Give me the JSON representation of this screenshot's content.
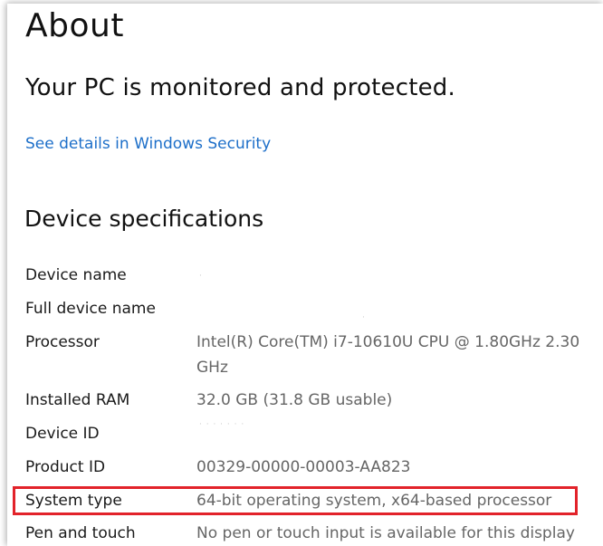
{
  "page": {
    "title": "About"
  },
  "security": {
    "heading": "Your PC is monitored and protected.",
    "link": "See details in Windows Security"
  },
  "specs": {
    "heading": "Device specifications",
    "rows": [
      {
        "label": "Device name",
        "value": ""
      },
      {
        "label": "Full device name",
        "value": ""
      },
      {
        "label": "Processor",
        "value_line1": "Intel(R) Core(TM) i7-10610U CPU @ 1.80GHz   2.30",
        "value_line2": "GHz"
      },
      {
        "label": "Installed RAM",
        "value": "32.0 GB (31.8 GB usable)"
      },
      {
        "label": "Device ID",
        "value": ""
      },
      {
        "label": "Product ID",
        "value": "00329-00000-00003-AA823"
      },
      {
        "label": "System type",
        "value": "64-bit operating system, x64-based processor"
      },
      {
        "label": "Pen and touch",
        "value": "No pen or touch input is available for this display"
      }
    ]
  },
  "highlight": {
    "color": "#e2232a",
    "target": "System type"
  },
  "colors": {
    "link": "#1d6fc9",
    "value_text": "#666666"
  }
}
